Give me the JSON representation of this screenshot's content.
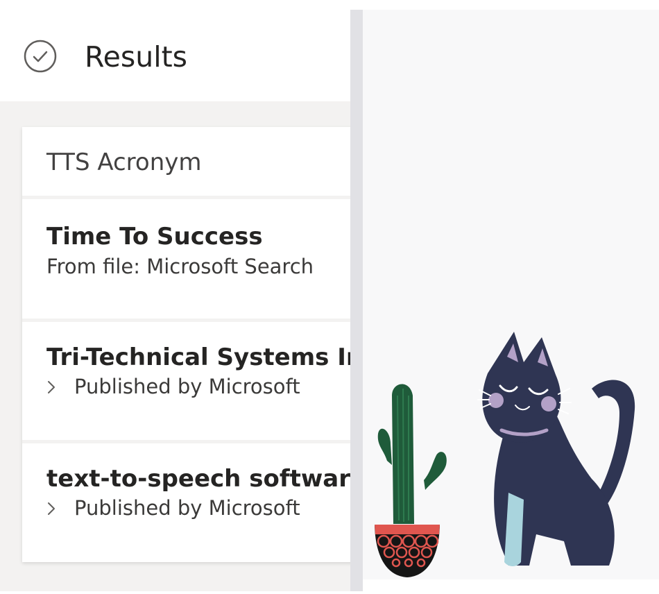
{
  "header": {
    "title": "Results",
    "status_icon": "check-circle-icon"
  },
  "results": {
    "query_label": "TTS Acronym",
    "items": [
      {
        "title": "Time To Success",
        "subtitle": "From file: Microsoft Search",
        "has_chevron": false
      },
      {
        "title": "Tri-Technical Systems Inc",
        "subtitle": "Published by Microsoft",
        "has_chevron": true
      },
      {
        "title": "text-to-speech software",
        "subtitle": "Published by Microsoft",
        "has_chevron": true
      }
    ]
  },
  "illustration": {
    "icons": [
      "cactus-icon",
      "cat-icon"
    ],
    "colors": {
      "cat": "#2f3553",
      "cactus": "#1f5b3a",
      "pot": "#151515",
      "pot_pattern": "#e0564f",
      "background": "#f8f8f9"
    }
  }
}
